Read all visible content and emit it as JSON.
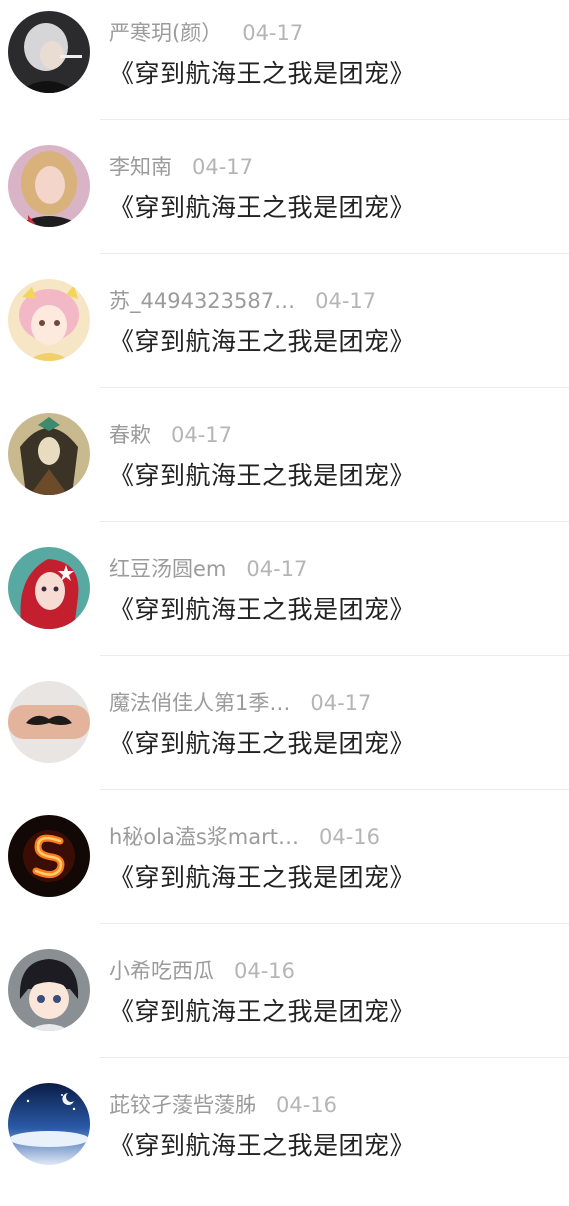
{
  "messages": [
    {
      "username": "严寒玥(颜）",
      "date": "04-17",
      "text": "《穿到航海王之我是团宠》",
      "avatar": "grey-hair-person-avatar"
    },
    {
      "username": "李知南",
      "date": "04-17",
      "text": "《穿到航海王之我是团宠》",
      "avatar": "blonde-girl-avatar"
    },
    {
      "username": "苏_4494323587…",
      "date": "04-17",
      "text": "《穿到航海王之我是团宠》",
      "avatar": "anime-girl-pink-avatar"
    },
    {
      "username": "春欶",
      "date": "04-17",
      "text": "《穿到航海王之我是团宠》",
      "avatar": "dark-art-girl-avatar"
    },
    {
      "username": "红豆汤圆em",
      "date": "04-17",
      "text": "《穿到航海王之我是团宠》",
      "avatar": "red-hair-mermaid-avatar"
    },
    {
      "username": "魔法俏佳人第1季…",
      "date": "04-17",
      "text": "《穿到航海王之我是团宠》",
      "avatar": "mustache-finger-avatar"
    },
    {
      "username": "h秘ola溘s浆mart…",
      "date": "04-16",
      "text": "《穿到航海王之我是团宠》",
      "avatar": "fire-letter-s-avatar"
    },
    {
      "username": "小希吃西瓜",
      "date": "04-16",
      "text": "《穿到航海王之我是团宠》",
      "avatar": "anime-boy-avatar"
    },
    {
      "username": "茈铰孑蔆呰蔆胏",
      "date": "04-16",
      "text": "《穿到航海王之我是团宠》",
      "avatar": "night-sky-avatar"
    }
  ]
}
